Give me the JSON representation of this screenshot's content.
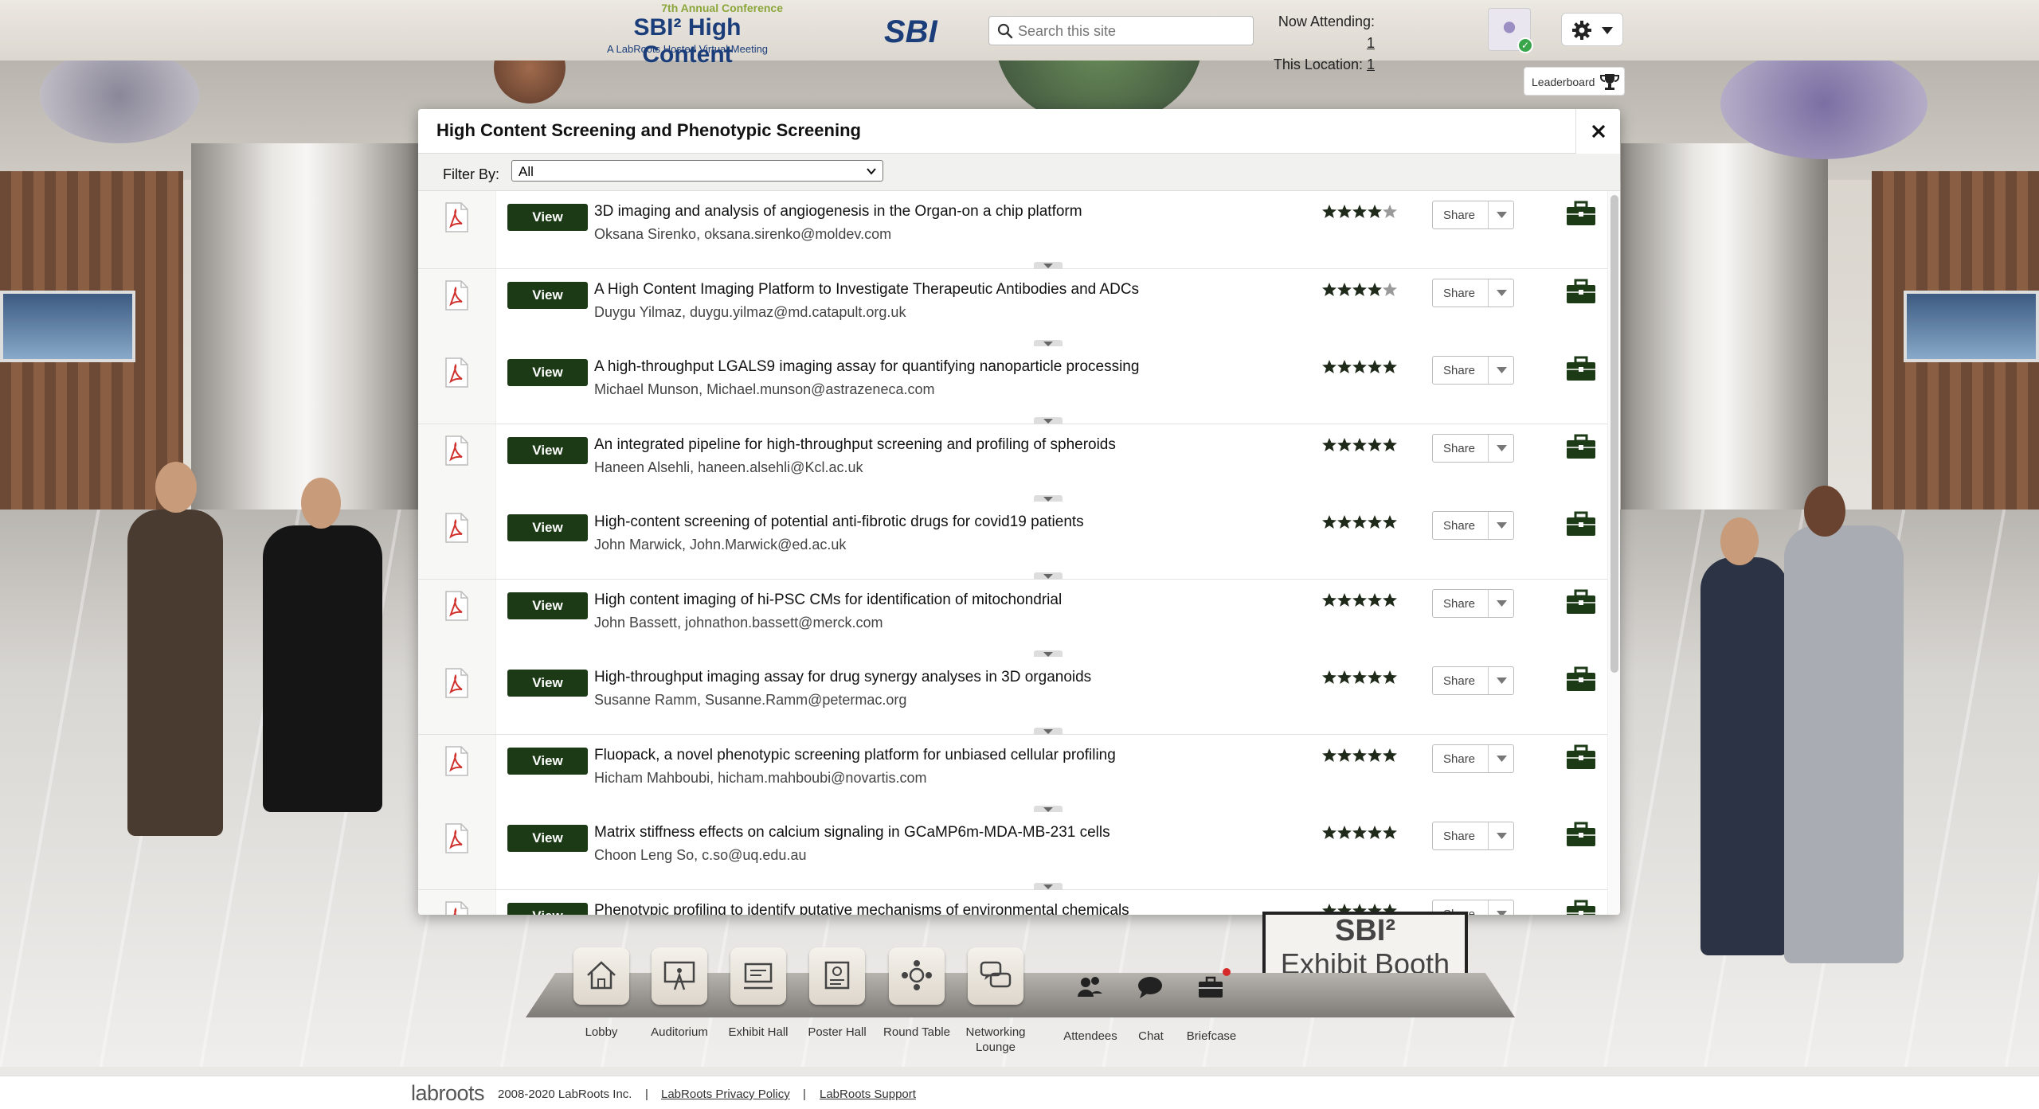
{
  "header": {
    "logo_sub": "7th Annual Conference",
    "logo_main": "SBI² High Content",
    "logo_tag": "A LabRoots Hosted Virtual Meeting",
    "partner_logo": "SBI",
    "search_placeholder": "Search this site",
    "now_attending_label": "Now Attending:",
    "now_attending_value": "1",
    "this_location_label": "This Location:",
    "this_location_value": "1",
    "leaderboard_label": "Leaderboard"
  },
  "modal": {
    "title": "High Content Screening and Phenotypic Screening",
    "filter_label": "Filter By:",
    "filter_value": "All",
    "view_label": "View",
    "share_label": "Share",
    "rows": [
      {
        "title": "3D imaging and analysis of angiogenesis in the Organ-on a chip platform",
        "author": "Oksana Sirenko, oksana.sirenko@moldev.com",
        "rating": 4
      },
      {
        "title": "A High Content Imaging Platform to Investigate Therapeutic Antibodies and ADCs",
        "author": "Duygu Yilmaz, duygu.yilmaz@md.catapult.org.uk",
        "rating": 4
      },
      {
        "title": "A high-throughput LGALS9 imaging assay for quantifying nanoparticle processing",
        "author": "Michael Munson, Michael.munson@astrazeneca.com",
        "rating": 5
      },
      {
        "title": "An integrated pipeline for high-throughput screening and profiling of spheroids",
        "author": "Haneen Alsehli, haneen.alsehli@Kcl.ac.uk",
        "rating": 5
      },
      {
        "title": "High-content screening of potential anti-fibrotic drugs for covid19 patients",
        "author": "John Marwick, John.Marwick@ed.ac.uk",
        "rating": 5
      },
      {
        "title": "High content imaging of hi-PSC CMs for identification of mitochondrial",
        "author": "John Bassett, johnathon.bassett@merck.com",
        "rating": 5
      },
      {
        "title": "High-throughput imaging assay for drug synergy analyses in 3D organoids",
        "author": "Susanne Ramm, Susanne.Ramm@petermac.org",
        "rating": 5
      },
      {
        "title": "Fluopack, a novel phenotypic screening platform for unbiased cellular profiling",
        "author": "Hicham Mahboubi, hicham.mahboubi@novartis.com",
        "rating": 5
      },
      {
        "title": "Matrix stiffness effects on calcium signaling in GCaMP6m-MDA-MB-231 cells",
        "author": "Choon Leng So, c.so@uq.edu.au",
        "rating": 5
      },
      {
        "title": "Phenotypic profiling to identify putative mechanisms of environmental chemicals",
        "author": "",
        "rating": 5
      }
    ]
  },
  "booth_sign": {
    "line1": "SBI²",
    "line2": "Exhibit Booth"
  },
  "nav": {
    "lobby": "Lobby",
    "auditorium": "Auditorium",
    "exhibit_hall": "Exhibit Hall",
    "poster_hall": "Poster Hall",
    "round_table": "Round Table",
    "networking_lounge": "Networking Lounge",
    "attendees": "Attendees",
    "chat": "Chat",
    "briefcase": "Briefcase"
  },
  "footer": {
    "logo": "labroots",
    "copyright": "2008-2020 LabRoots Inc.",
    "privacy": "LabRoots Privacy Policy",
    "support": "LabRoots Support"
  },
  "colors": {
    "accent": "#1b3a15",
    "brand_blue": "#1b3e7a",
    "brand_green": "#8ba63a"
  }
}
